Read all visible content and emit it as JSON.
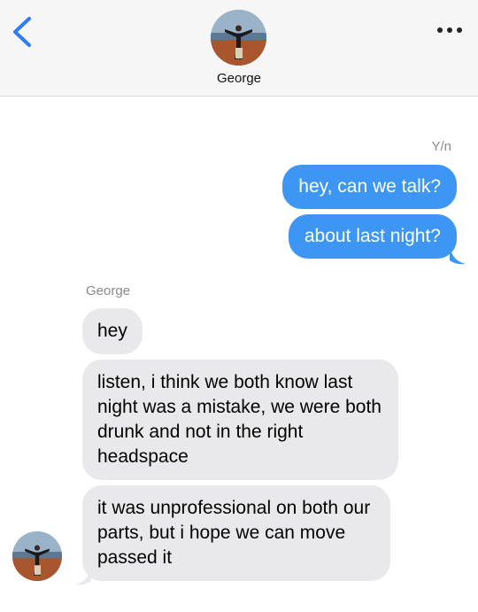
{
  "header": {
    "contact_name": "George",
    "back_icon": "chevron-left-icon",
    "more_icon": "ellipsis-icon",
    "accent": "#2f7cf6"
  },
  "messages": {
    "outgoing_sender": "Y/n",
    "incoming_sender": "George",
    "outgoing": [
      "hey, can we talk?",
      "about last night?"
    ],
    "incoming": [
      "hey",
      "listen, i think we both know last night was a mistake, we were both drunk and not in the right headspace",
      "it was unprofessional on both our parts, but i hope we can move passed it"
    ]
  },
  "colors": {
    "outgoing_bubble": "#3e96f4",
    "incoming_bubble": "#e9e9eb",
    "header_bg": "#f6f6f6"
  }
}
